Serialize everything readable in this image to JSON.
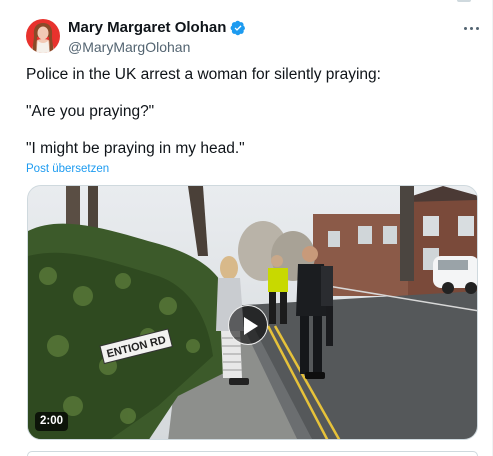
{
  "tweet": {
    "author": {
      "name": "Mary Margaret Olohan",
      "handle": "@MaryMargOlohan",
      "verified": true
    },
    "text_lines": [
      "Police in the UK arrest a woman for silently praying:",
      "\"Are you praying?\"",
      "\"I might be praying in my head.\""
    ],
    "translate_label": "Post übersetzen",
    "media": {
      "type": "video",
      "duration": "2:00",
      "sign_text": "ENTION RD"
    }
  },
  "colors": {
    "accent": "#1d9bf0",
    "text_primary": "#0f1419",
    "text_secondary": "#536471"
  },
  "icons": [
    "verified-badge-icon",
    "more-options-icon",
    "play-icon"
  ]
}
